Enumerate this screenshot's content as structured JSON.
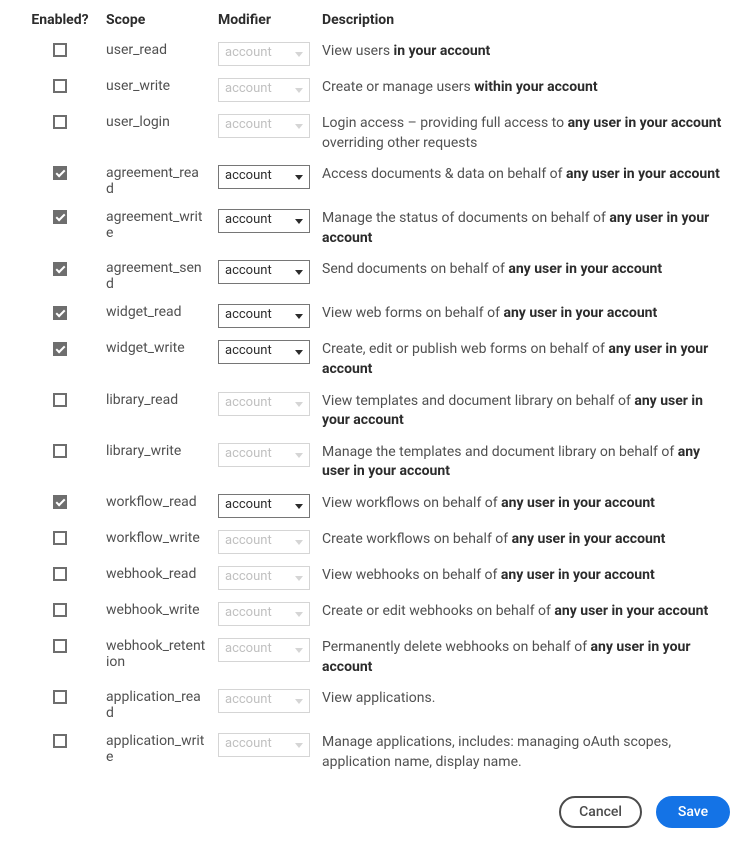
{
  "headers": {
    "enabled": "Enabled?",
    "scope": "Scope",
    "modifier": "Modifier",
    "description": "Description"
  },
  "modifier_value": "account",
  "rows": [
    {
      "id": "user_read",
      "enabled": false,
      "scope": "user_read",
      "desc_pre": "View users ",
      "desc_bold": "in your account",
      "desc_post": ""
    },
    {
      "id": "user_write",
      "enabled": false,
      "scope": "user_write",
      "desc_pre": "Create or manage users ",
      "desc_bold": "within your account",
      "desc_post": ""
    },
    {
      "id": "user_login",
      "enabled": false,
      "scope": "user_login",
      "desc_pre": "Login access – providing full access to ",
      "desc_bold": "any user in your account",
      "desc_post": " overriding other requests"
    },
    {
      "id": "agreement_read",
      "enabled": true,
      "scope": "agreement_read",
      "desc_pre": "Access documents & data on behalf of ",
      "desc_bold": "any user in your account",
      "desc_post": ""
    },
    {
      "id": "agreement_write",
      "enabled": true,
      "scope": "agreement_write",
      "desc_pre": "Manage the status of documents on behalf of ",
      "desc_bold": "any user in your account",
      "desc_post": ""
    },
    {
      "id": "agreement_send",
      "enabled": true,
      "scope": "agreement_send",
      "desc_pre": "Send documents on behalf of ",
      "desc_bold": "any user in your account",
      "desc_post": ""
    },
    {
      "id": "widget_read",
      "enabled": true,
      "scope": "widget_read",
      "desc_pre": "View web forms on behalf of ",
      "desc_bold": "any user in your account",
      "desc_post": ""
    },
    {
      "id": "widget_write",
      "enabled": true,
      "scope": "widget_write",
      "desc_pre": "Create, edit or publish web forms on behalf of ",
      "desc_bold": "any user in your account",
      "desc_post": ""
    },
    {
      "id": "library_read",
      "enabled": false,
      "scope": "library_read",
      "desc_pre": "View templates and document library on behalf of ",
      "desc_bold": "any user in your account",
      "desc_post": ""
    },
    {
      "id": "library_write",
      "enabled": false,
      "scope": "library_write",
      "desc_pre": "Manage the templates and document library on behalf of ",
      "desc_bold": "any user in your account",
      "desc_post": ""
    },
    {
      "id": "workflow_read",
      "enabled": true,
      "scope": "workflow_read",
      "desc_pre": "View workflows on behalf of ",
      "desc_bold": "any user in your account",
      "desc_post": ""
    },
    {
      "id": "workflow_write",
      "enabled": false,
      "scope": "workflow_write",
      "desc_pre": "Create workflows on behalf of ",
      "desc_bold": "any user in your account",
      "desc_post": ""
    },
    {
      "id": "webhook_read",
      "enabled": false,
      "scope": "webhook_read",
      "desc_pre": "View webhooks on behalf of ",
      "desc_bold": "any user in your account",
      "desc_post": ""
    },
    {
      "id": "webhook_write",
      "enabled": false,
      "scope": "webhook_write",
      "desc_pre": "Create or edit webhooks on behalf of ",
      "desc_bold": "any user in your account",
      "desc_post": ""
    },
    {
      "id": "webhook_retention",
      "enabled": false,
      "scope": "webhook_retention",
      "desc_pre": "Permanently delete webhooks on behalf of ",
      "desc_bold": "any user in your account",
      "desc_post": ""
    },
    {
      "id": "application_read",
      "enabled": false,
      "scope": "application_read",
      "desc_pre": "View applications.",
      "desc_bold": "",
      "desc_post": ""
    },
    {
      "id": "application_write",
      "enabled": false,
      "scope": "application_write",
      "desc_pre": "Manage applications, includes: managing oAuth scopes, application name, display name.",
      "desc_bold": "",
      "desc_post": ""
    }
  ],
  "buttons": {
    "cancel": "Cancel",
    "save": "Save"
  }
}
